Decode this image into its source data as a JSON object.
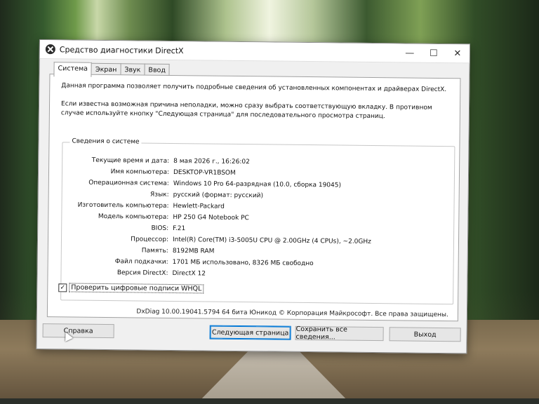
{
  "window": {
    "title": "Средство диагностики DirectX",
    "tabs": [
      "Система",
      "Экран",
      "Звук",
      "Ввод"
    ]
  },
  "intro": {
    "line1": "Данная программа позволяет получить подробные сведения об установленных компонентах и драйверах DirectX.",
    "line2": "Если известна возможная причина неполадки, можно сразу выбрать соответствующую вкладку. В противном случае используйте кнопку \"Следующая страница\" для последовательного просмотра страниц."
  },
  "system_info": {
    "group_label": "Сведения о системе",
    "rows": [
      {
        "label": "Текущие время и дата:",
        "value": "8 мая 2026 г., 16:26:02"
      },
      {
        "label": "Имя компьютера:",
        "value": "DESKTOP-VR1BSOM"
      },
      {
        "label": "Операционная система:",
        "value": "Windows 10 Pro 64-разрядная (10.0, сборка 19045)"
      },
      {
        "label": "Язык:",
        "value": "русский (формат: русский)"
      },
      {
        "label": "Изготовитель компьютера:",
        "value": "Hewlett-Packard"
      },
      {
        "label": "Модель компьютера:",
        "value": "HP 250 G4 Notebook PC"
      },
      {
        "label": "BIOS:",
        "value": "F.21"
      },
      {
        "label": "Процессор:",
        "value": "Intel(R) Core(TM) i3-5005U CPU @ 2.00GHz (4 CPUs), ~2.0GHz"
      },
      {
        "label": "Память:",
        "value": "8192MB RAM"
      },
      {
        "label": "Файл подкачки:",
        "value": "1701 МБ использовано, 8326 МБ свободно"
      },
      {
        "label": "Версия DirectX:",
        "value": "DirectX 12"
      }
    ]
  },
  "checkbox": {
    "label": "Проверить цифровые подписи WHQL",
    "checked": true
  },
  "footer": {
    "version_text": "DxDiag 10.00.19041.5794 64 бита Юникод  © Корпорация Майкрософт. Все права защищены."
  },
  "buttons": {
    "help": "Справка",
    "next": "Следующая страница",
    "save": "Сохранить все сведения...",
    "exit": "Выход"
  },
  "titlebar_icons": {
    "minimize": "minimize-icon",
    "maximize": "maximize-icon",
    "close": "close-icon"
  }
}
